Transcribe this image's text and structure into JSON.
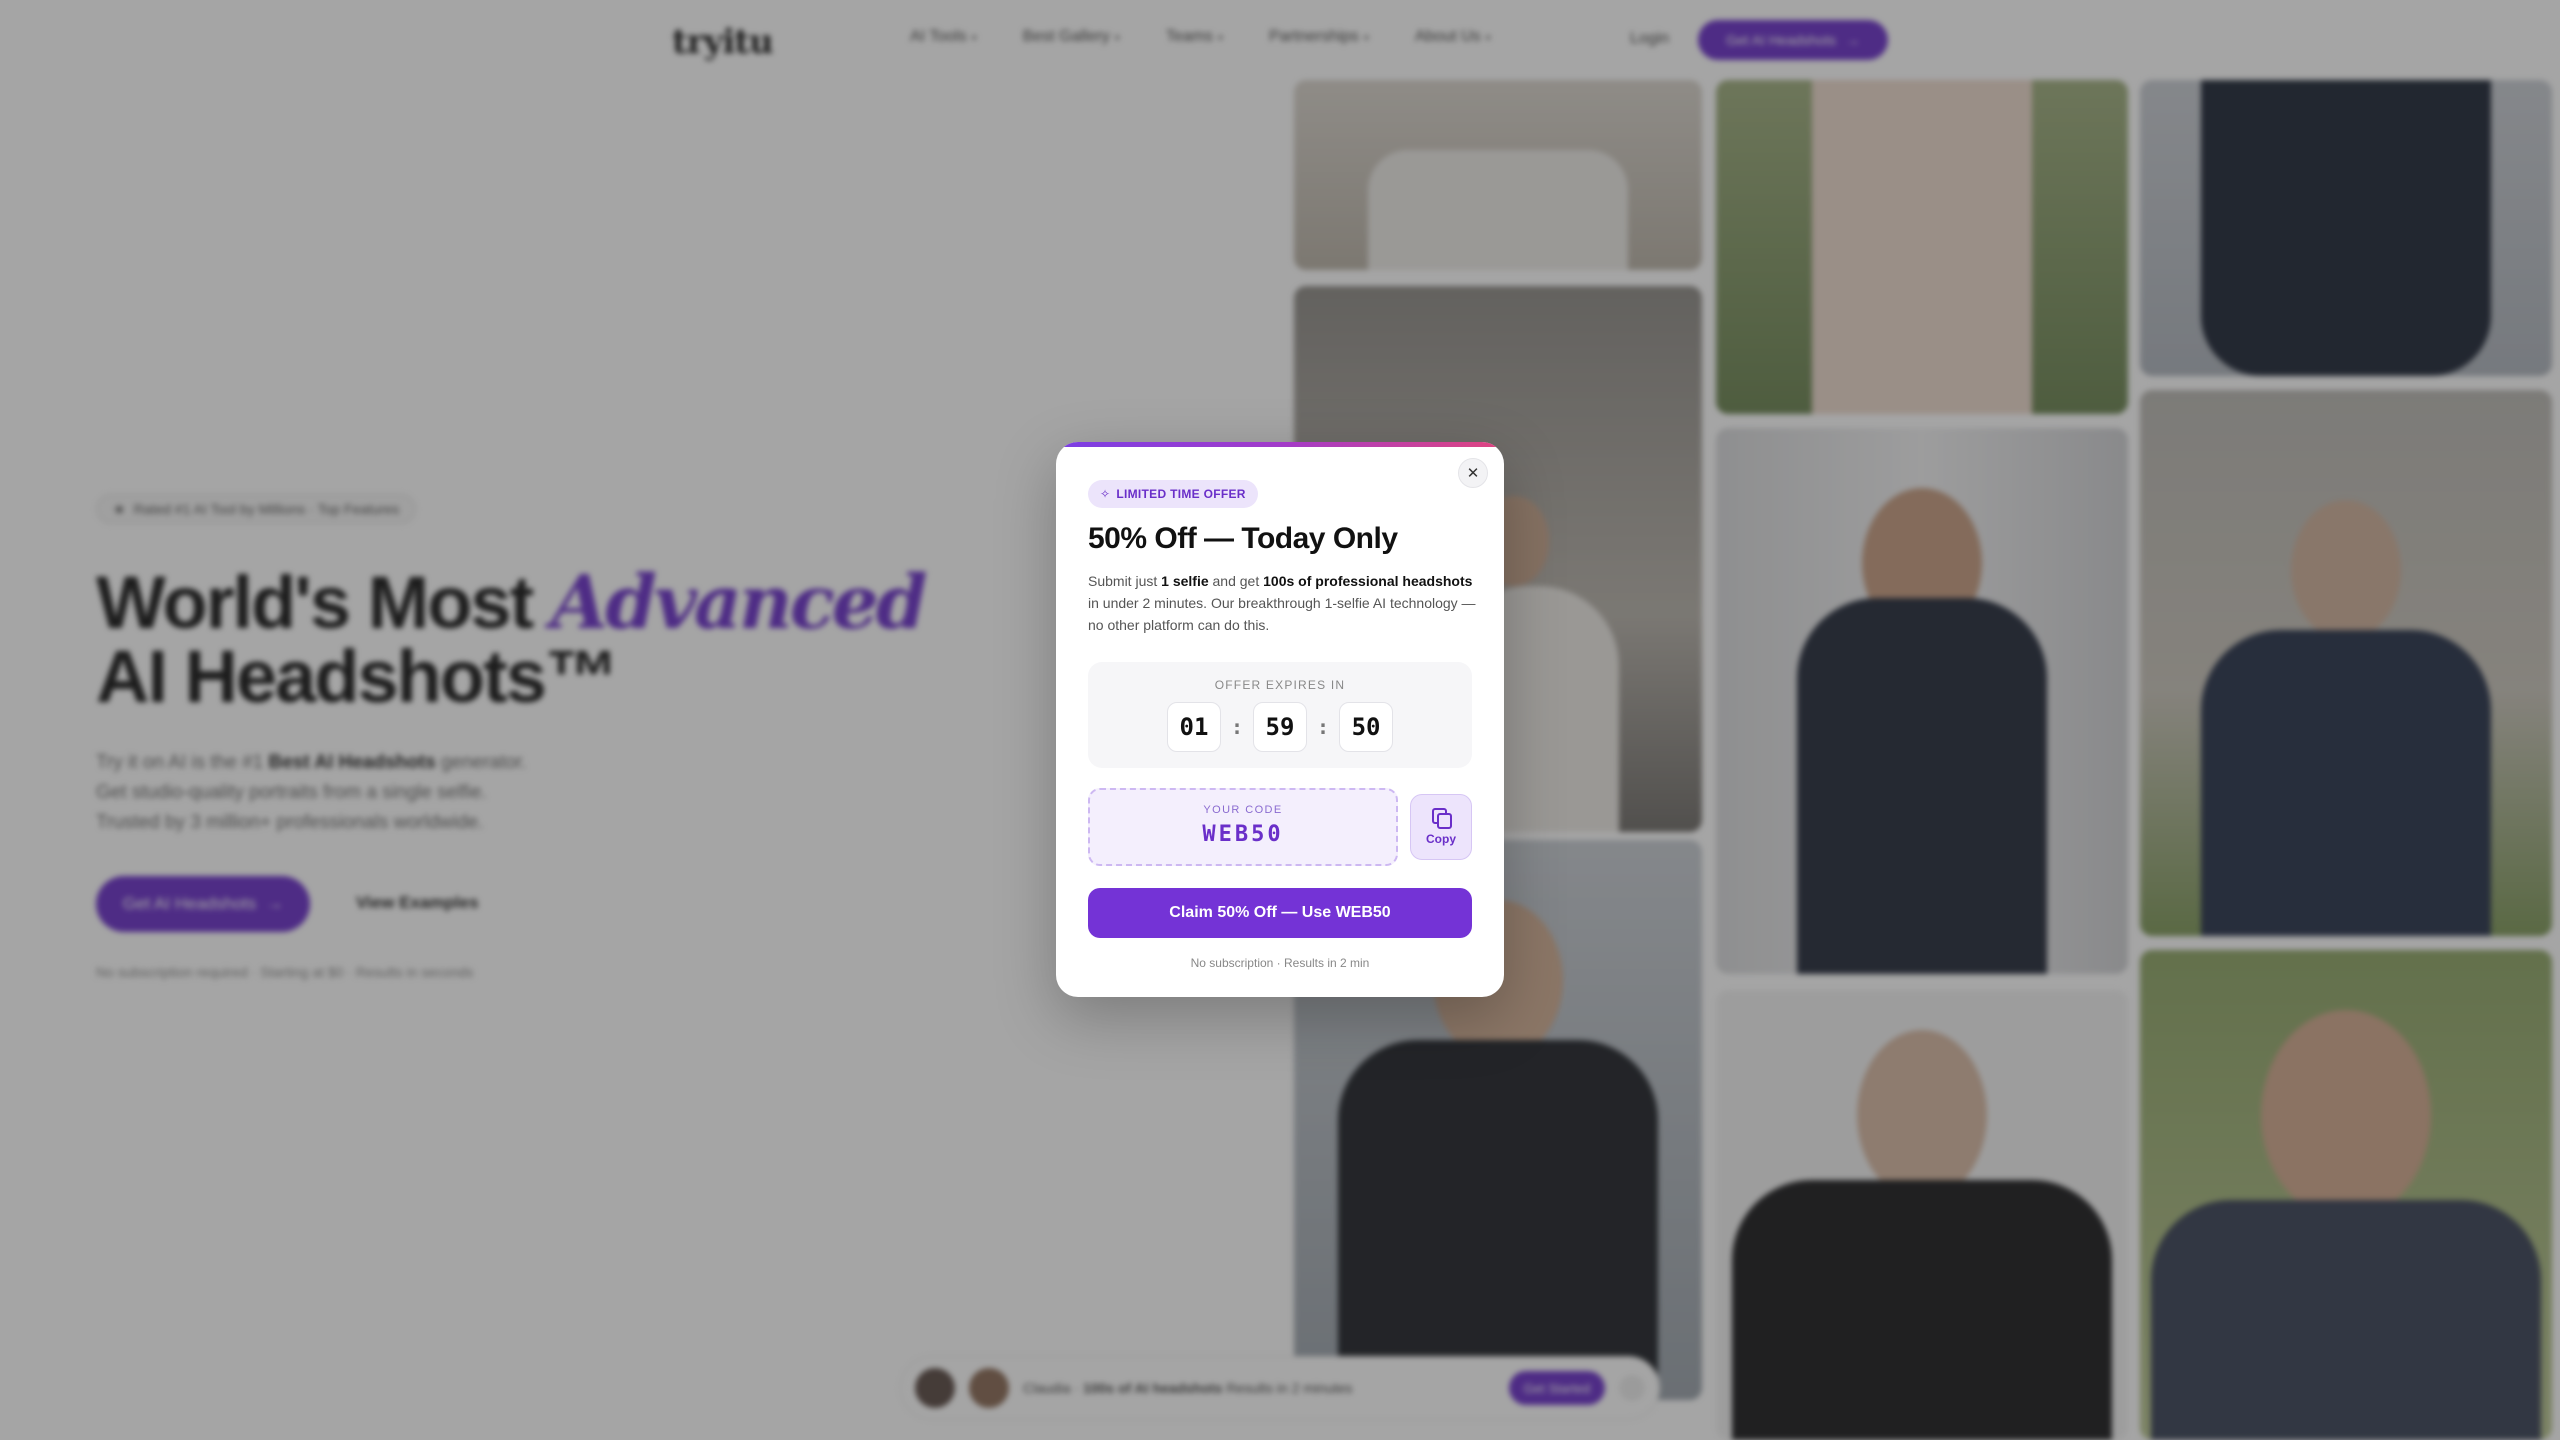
{
  "nav": {
    "logo": "tryitu",
    "links": [
      "AI Tools",
      "Best Gallery",
      "Teams",
      "Partnerships",
      "About Us"
    ],
    "login": "Login",
    "cta": "Get AI Headshots"
  },
  "hero": {
    "badge": "Rated #1 AI Tool by Millions · Top Features",
    "title_line1": "World's Most ",
    "title_accent": "Advanced",
    "title_line2": "AI Headshots™",
    "sub_prefix": "Try it on AI is the #1 ",
    "sub_bold": "Best AI Headshots",
    "sub_suffix": " generator. Get studio-quality portraits from a single selfie. Trusted by 3 million+ professionals worldwide.",
    "cta": "Get AI Headshots",
    "secondary": "View Examples",
    "footnote": "No subscription required · Starting at $0 · Results in seconds"
  },
  "bottom_bar": {
    "text_name": "Claudia",
    "text_bold": "100s of AI headshots",
    "text_rest": "Results in 2 minutes",
    "cta": "Get Started"
  },
  "modal": {
    "badge": "LIMITED TIME OFFER",
    "title": "50% Off — Today Only",
    "desc_1": "Submit just ",
    "desc_b1": "1 selfie",
    "desc_2": " and get ",
    "desc_b2": "100s of professional headshots",
    "desc_3": " in under 2 minutes. Our breakthrough 1-selfie AI technology — no other platform can do this.",
    "countdown_label": "OFFER EXPIRES IN",
    "hours": "01",
    "minutes": "59",
    "seconds": "50",
    "separator": ":",
    "code_label": "YOUR CODE",
    "code": "WEB50",
    "copy_label": "Copy",
    "claim": "Claim 50% Off — Use WEB50",
    "footnote": "No subscription · Results in 2 min",
    "close_symbol": "✕",
    "sparkle_symbol": "✧"
  },
  "colors": {
    "brand": "#6a2fc9",
    "overlay": "rgba(40,40,40,0.42)"
  }
}
